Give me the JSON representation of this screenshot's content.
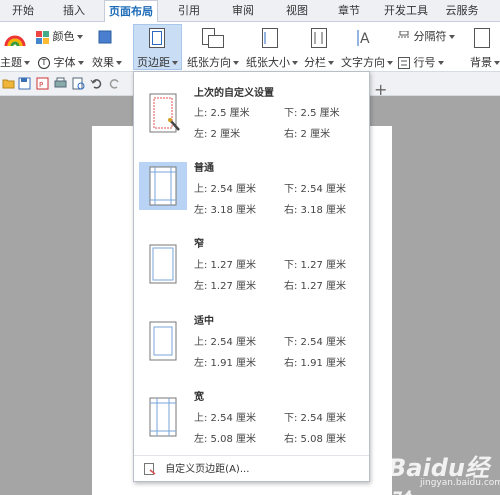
{
  "tabs": [
    "开始",
    "插入",
    "页面布局",
    "引用",
    "审阅",
    "视图",
    "章节",
    "开发工具",
    "云服务"
  ],
  "active_tab": "页面布局",
  "ribbon": {
    "theme": "主题",
    "color": "颜色",
    "font": "字体",
    "effect": "效果",
    "margin": "页边距",
    "orientation": "纸张方向",
    "size": "纸张大小",
    "columns": "分栏",
    "text_direction": "文字方向",
    "separator": "分隔符",
    "line_number": "行号",
    "background": "背景"
  },
  "margins": {
    "options": [
      {
        "title": "上次的自定义设置",
        "top": "上: 2.5 厘米",
        "bottom": "下: 2.5 厘米",
        "left": "左: 2 厘米",
        "right": "右: 2 厘米",
        "selected": false
      },
      {
        "title": "普通",
        "top": "上: 2.54 厘米",
        "bottom": "下: 2.54 厘米",
        "left": "左: 3.18 厘米",
        "right": "右: 3.18 厘米",
        "selected": true
      },
      {
        "title": "窄",
        "top": "上: 1.27 厘米",
        "bottom": "下: 1.27 厘米",
        "left": "左: 1.27 厘米",
        "right": "右: 1.27 厘米",
        "selected": false
      },
      {
        "title": "适中",
        "top": "上: 2.54 厘米",
        "bottom": "下: 2.54 厘米",
        "left": "左: 1.91 厘米",
        "right": "右: 1.91 厘米",
        "selected": false
      },
      {
        "title": "宽",
        "top": "上: 2.54 厘米",
        "bottom": "下: 2.54 厘米",
        "left": "左: 5.08 厘米",
        "right": "右: 5.08 厘米",
        "selected": false
      }
    ],
    "custom": "自定义页边距(A)..."
  },
  "watermark": "Baidu经验",
  "watermark_sub": "jingyan.baidu.com",
  "colors": {
    "accent": "#1c6bb8",
    "selected_bg": "#b8d3f3",
    "ribbon_selected": "#c9def5"
  }
}
